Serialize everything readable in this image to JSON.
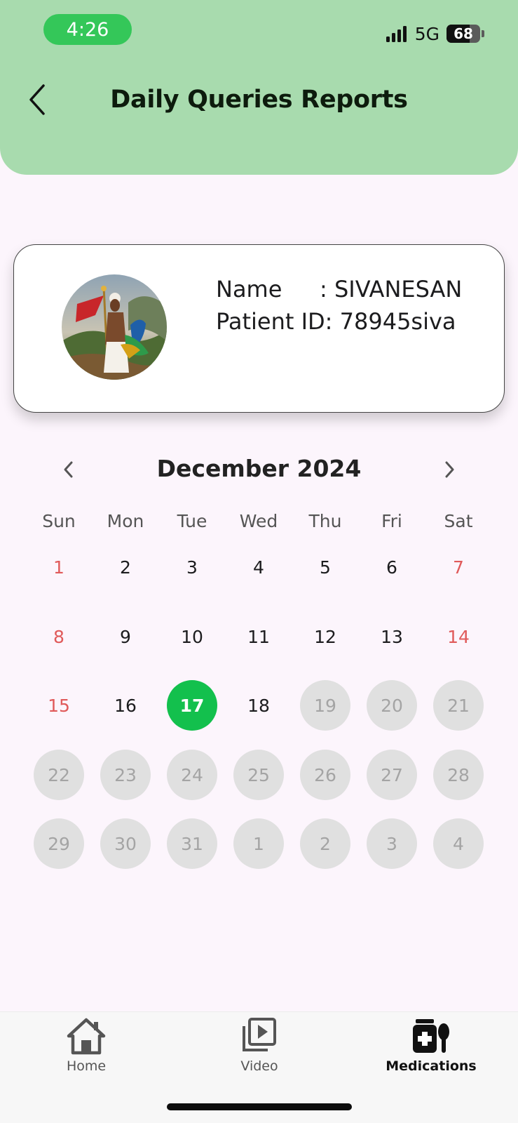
{
  "status_bar": {
    "time": "4:26",
    "network": "5G",
    "battery_percent": "68",
    "battery_level": 0.68
  },
  "header": {
    "title": "Daily Queries Reports",
    "back_icon": "chevron-left-icon"
  },
  "patient": {
    "name_label": "Name",
    "name_value": ": SIVANESAN",
    "id_label": "Patient ID:",
    "id_value": "78945siva"
  },
  "calendar": {
    "month_title": "December 2024",
    "weekdays": [
      "Sun",
      "Mon",
      "Tue",
      "Wed",
      "Thu",
      "Fri",
      "Sat"
    ],
    "selected_day": "17",
    "weeks": [
      [
        {
          "d": "1",
          "state": "weekend"
        },
        {
          "d": "2",
          "state": "normal"
        },
        {
          "d": "3",
          "state": "normal"
        },
        {
          "d": "4",
          "state": "normal"
        },
        {
          "d": "5",
          "state": "normal"
        },
        {
          "d": "6",
          "state": "normal"
        },
        {
          "d": "7",
          "state": "weekend"
        }
      ],
      [
        {
          "d": "8",
          "state": "weekend"
        },
        {
          "d": "9",
          "state": "normal"
        },
        {
          "d": "10",
          "state": "normal"
        },
        {
          "d": "11",
          "state": "normal"
        },
        {
          "d": "12",
          "state": "normal"
        },
        {
          "d": "13",
          "state": "normal"
        },
        {
          "d": "14",
          "state": "weekend"
        }
      ],
      [
        {
          "d": "15",
          "state": "weekend"
        },
        {
          "d": "16",
          "state": "normal"
        },
        {
          "d": "17",
          "state": "selected"
        },
        {
          "d": "18",
          "state": "normal"
        },
        {
          "d": "19",
          "state": "disabled"
        },
        {
          "d": "20",
          "state": "disabled"
        },
        {
          "d": "21",
          "state": "disabled"
        }
      ],
      [
        {
          "d": "22",
          "state": "disabled"
        },
        {
          "d": "23",
          "state": "disabled"
        },
        {
          "d": "24",
          "state": "disabled"
        },
        {
          "d": "25",
          "state": "disabled"
        },
        {
          "d": "26",
          "state": "disabled"
        },
        {
          "d": "27",
          "state": "disabled"
        },
        {
          "d": "28",
          "state": "disabled"
        }
      ],
      [
        {
          "d": "29",
          "state": "disabled"
        },
        {
          "d": "30",
          "state": "disabled"
        },
        {
          "d": "31",
          "state": "disabled"
        },
        {
          "d": "1",
          "state": "disabled"
        },
        {
          "d": "2",
          "state": "disabled"
        },
        {
          "d": "3",
          "state": "disabled"
        },
        {
          "d": "4",
          "state": "disabled"
        }
      ]
    ]
  },
  "tabs": [
    {
      "label": "Home",
      "icon": "home-icon",
      "active": false
    },
    {
      "label": "Video",
      "icon": "video-library-icon",
      "active": false
    },
    {
      "label": "Medications",
      "icon": "medications-icon",
      "active": true
    }
  ],
  "colors": {
    "header_bg": "#a8dbae",
    "accent_green": "#13c04d",
    "weekend_red": "#e05a5a",
    "disabled_gray": "#e0e0e0"
  }
}
